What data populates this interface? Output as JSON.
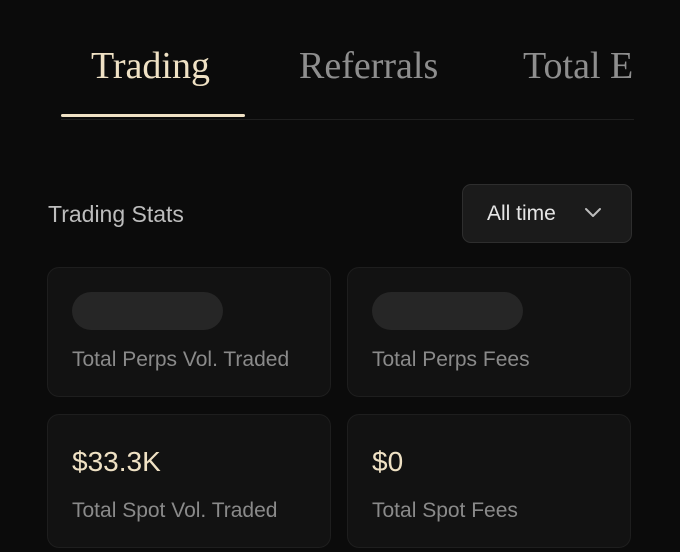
{
  "tabs": [
    {
      "label": "Trading",
      "active": true
    },
    {
      "label": "Referrals",
      "active": false
    },
    {
      "label": "Total E",
      "active": false
    }
  ],
  "stats": {
    "title": "Trading Stats",
    "range": {
      "selected": "All time",
      "icon": "chevron-down-icon"
    },
    "cards": [
      {
        "label": "Total Perps Vol. Traded",
        "value": null,
        "state": "loading"
      },
      {
        "label": "Total Perps Fees",
        "value": null,
        "state": "loading"
      },
      {
        "label": "Total Spot Vol. Traded",
        "value": "$33.3K",
        "state": "loaded"
      },
      {
        "label": "Total Spot Fees",
        "value": "$0",
        "state": "loaded"
      }
    ]
  },
  "colors": {
    "background": "#0b0b0b",
    "accent": "#efe1c4",
    "card_background": "#121212",
    "muted_text": "#8a8a8a",
    "skeleton": "#262626"
  }
}
